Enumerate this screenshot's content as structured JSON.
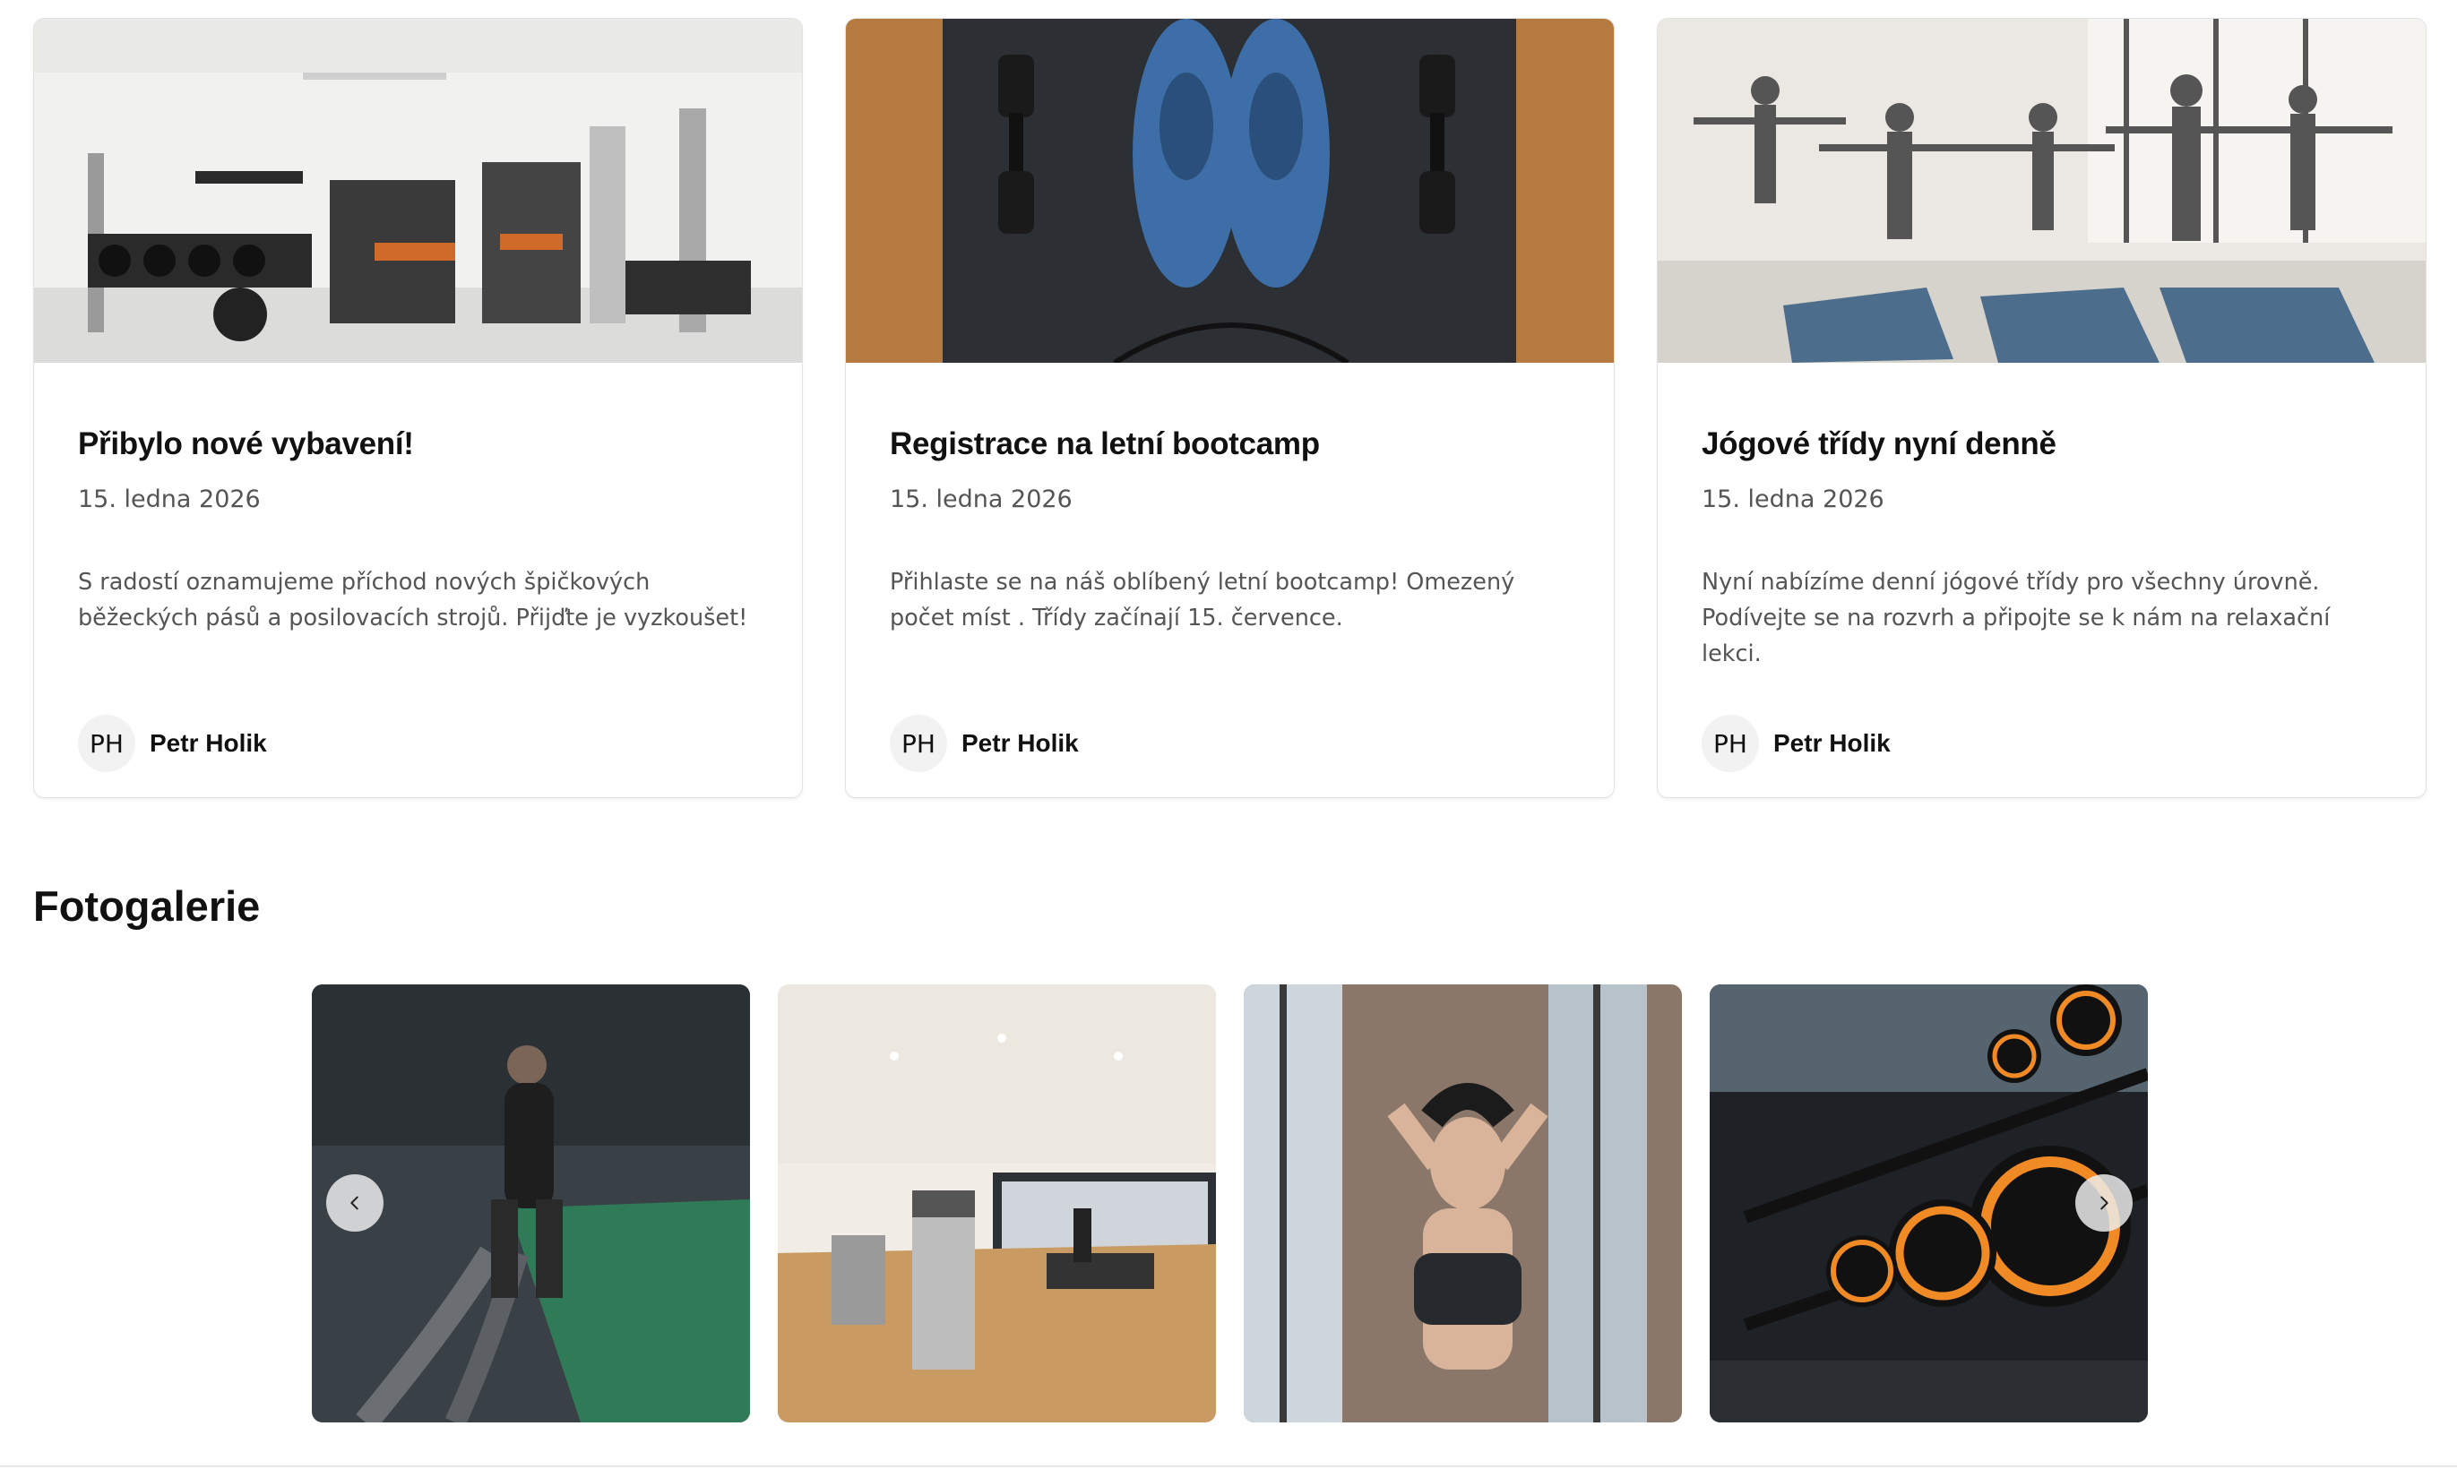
{
  "news": [
    {
      "title": "Přibylo nové vybavení!",
      "date": "15. ledna 2026",
      "excerpt": "S radostí oznamujeme příchod nových špičkových běžeckých pásů a posilovacích strojů. Přijďte je vyzkoušet!",
      "author_initials": "PH",
      "author_name": "Petr Holik",
      "image": "gym-equipment-photo"
    },
    {
      "title": "Registrace na letní bootcamp",
      "date": "15. ledna 2026",
      "excerpt": "Přihlaste se na náš oblíbený letní bootcamp! Omezený počet míst . Třídy začínají 15. července.",
      "author_initials": "PH",
      "author_name": "Petr Holik",
      "image": "dumbbells-and-shoes-photo"
    },
    {
      "title": "Jógové třídy nyní denně",
      "date": "15. ledna 2026",
      "excerpt": "Nyní nabízíme denní jógové třídy pro všechny úrovně. Podívejte se na rozvrh a připojte se k nám na relaxační lekci.",
      "author_initials": "PH",
      "author_name": "Petr Holik",
      "image": "yoga-class-photo"
    }
  ],
  "gallery": {
    "title": "Fotogalerie",
    "images": [
      "battle-ropes-photo",
      "gym-interior-photo",
      "woman-stretching-photo",
      "dumbbell-rack-photo"
    ],
    "prev_icon": "chevron-left-icon",
    "next_icon": "chevron-right-icon"
  },
  "colors": {
    "text": "#111111",
    "muted_text": "#555555",
    "card_border": "#e2e2e2",
    "avatar_bg": "#f2f2f2"
  }
}
